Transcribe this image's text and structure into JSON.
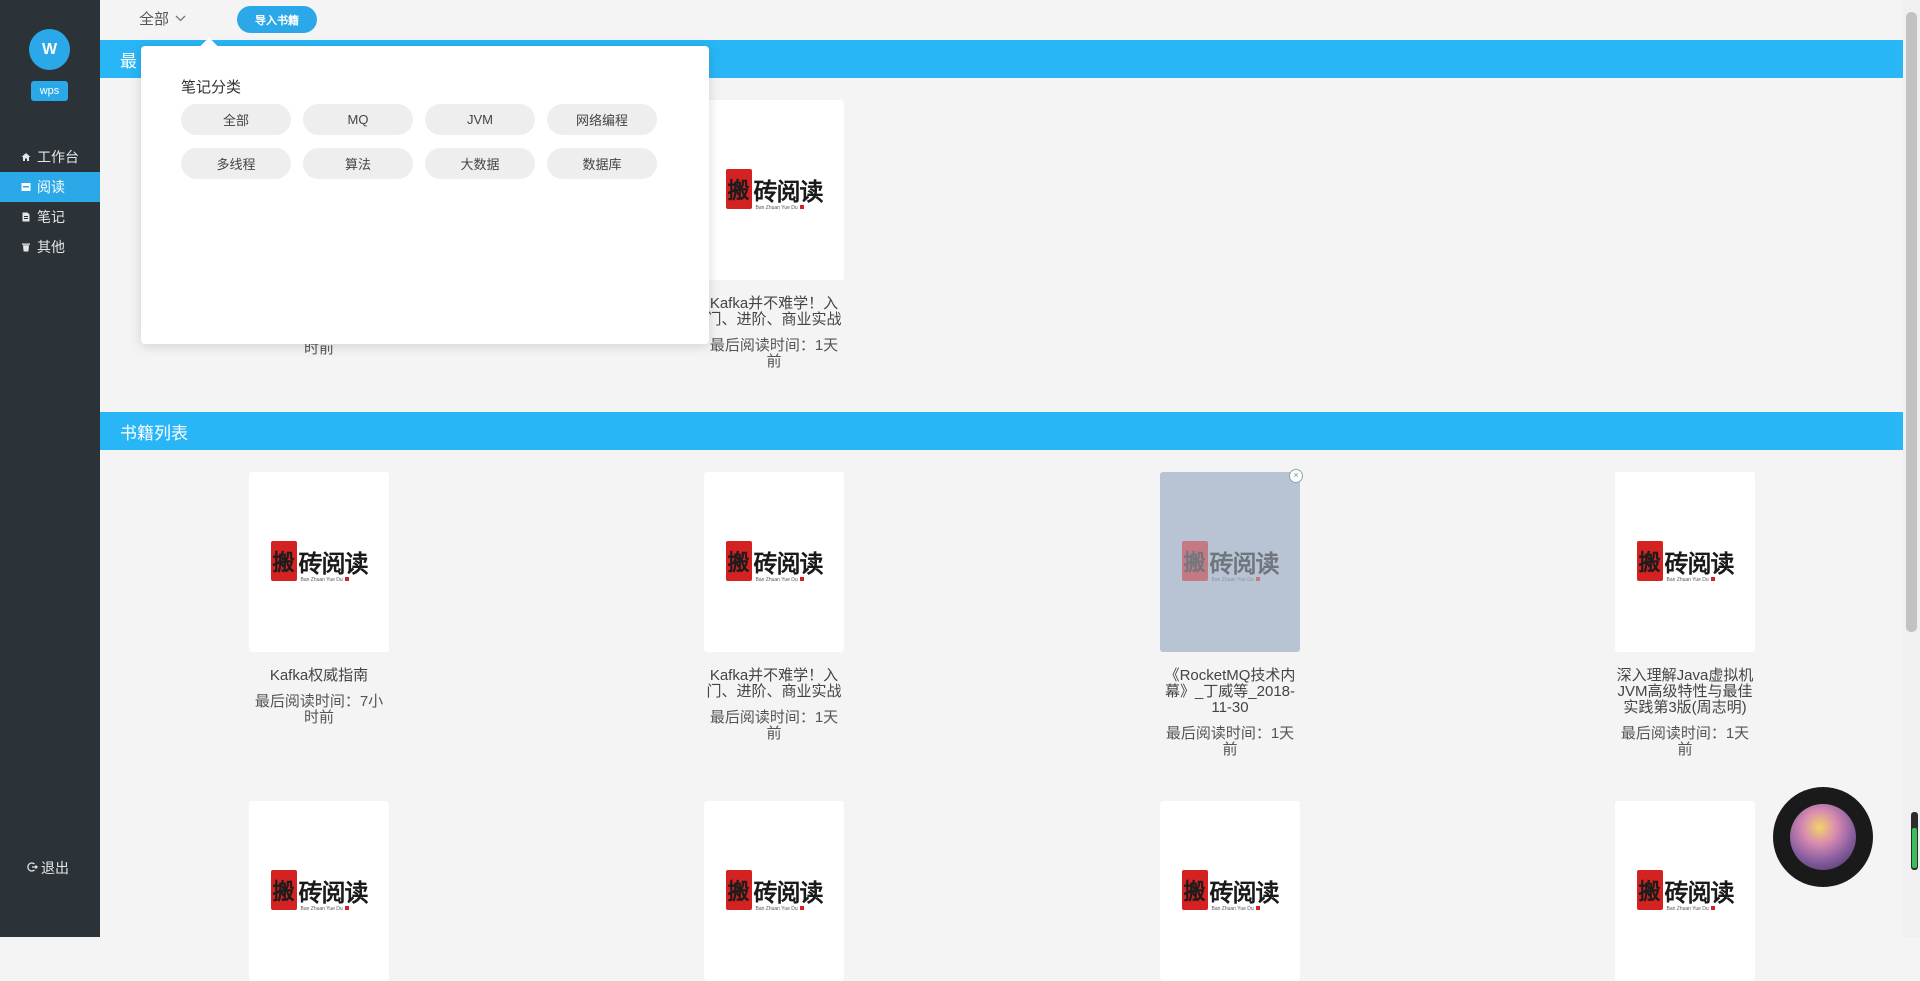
{
  "sidebar": {
    "avatar_letter": "W",
    "user_tag": "wps",
    "nav": [
      {
        "label": "工作台",
        "icon": "home-icon"
      },
      {
        "label": "阅读",
        "icon": "book-icon",
        "active": true
      },
      {
        "label": "笔记",
        "icon": "note-icon"
      },
      {
        "label": "其他",
        "icon": "trash-icon"
      }
    ],
    "logout": "退出"
  },
  "topbar": {
    "filter_label": "全部",
    "import_button": "导入书籍"
  },
  "recent_section": {
    "title_visible": "最",
    "cards": [
      {
        "title": "",
        "time": "时前"
      },
      {
        "title": "Kafka并不难学！入门、进阶、商业实战",
        "time": "最后阅读时间：1天前"
      }
    ]
  },
  "dropdown": {
    "title": "笔记分类",
    "chips": [
      "全部",
      "MQ",
      "JVM",
      "网络编程",
      "多线程",
      "算法",
      "大数据",
      "数据库"
    ]
  },
  "book_section": {
    "title": "书籍列表",
    "cards": [
      {
        "title": "Kafka权威指南",
        "time": "最后阅读时间：7小时前"
      },
      {
        "title": "Kafka并不难学！入门、进阶、商业实战",
        "time": "最后阅读时间：1天前"
      },
      {
        "title": "《RocketMQ技术内幕》_丁威等_2018-11-30",
        "time": "最后阅读时间：1天前"
      },
      {
        "title": "深入理解Java虚拟机JVM高级特性与最佳实践第3版(周志明)",
        "time": "最后阅读时间：1天前"
      }
    ]
  },
  "logo": {
    "seal_char": "搬",
    "chars": "砖阅读",
    "sub": "Ban Zhuan Yue Du"
  },
  "colors": {
    "accent": "#29b6f6",
    "sidebar_bg": "#2b3238",
    "seal_red": "#d42121"
  }
}
